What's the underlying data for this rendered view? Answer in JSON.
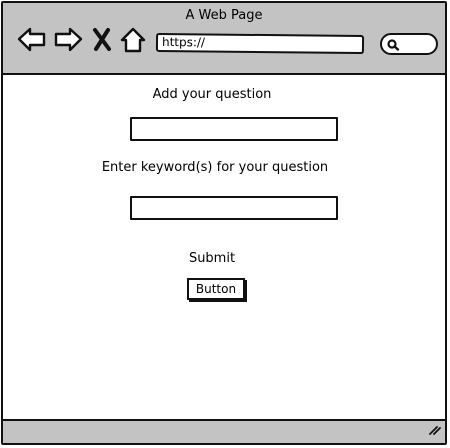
{
  "window": {
    "title": "A Web Page"
  },
  "toolbar": {
    "back_icon": "back-arrow-icon",
    "forward_icon": "forward-arrow-icon",
    "stop_icon": "close-x-icon",
    "home_icon": "home-icon",
    "address": "https://",
    "search_icon": "search-icon"
  },
  "form": {
    "question_label": "Add your question",
    "question_value": "",
    "keywords_label": "Enter keyword(s) for your question",
    "keywords_value": "",
    "submit_label": "Submit",
    "button_label": "Button"
  },
  "statusbar": {
    "grip_icon": "resize-grip-icon"
  }
}
